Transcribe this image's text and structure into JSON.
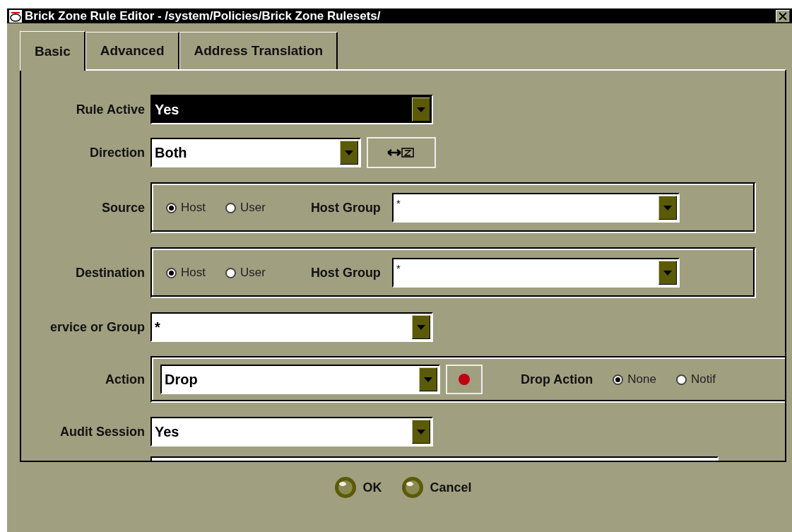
{
  "window": {
    "title": "Brick Zone Rule Editor - /system/Policies/Brick Zone Rulesets/"
  },
  "tabs": [
    {
      "label": "Basic",
      "selected": true
    },
    {
      "label": "Advanced",
      "selected": false
    },
    {
      "label": "Address Translation",
      "selected": false
    }
  ],
  "fields": [
    {
      "kind": "combo",
      "label": "Rule Active",
      "value": "Yes",
      "highlighted": true
    },
    {
      "kind": "combo-with-button",
      "label": "Direction",
      "value": "Both",
      "highlighted": false
    },
    {
      "kind": "endpoint",
      "label": "Source",
      "options": [
        {
          "label": "Host",
          "selected": true
        },
        {
          "label": "User",
          "selected": false
        }
      ],
      "group_label": "Host Group",
      "group_value": "*"
    },
    {
      "kind": "endpoint",
      "label": "Destination",
      "options": [
        {
          "label": "Host",
          "selected": true
        },
        {
          "label": "User",
          "selected": false
        }
      ],
      "group_label": "Host Group",
      "group_value": "*"
    },
    {
      "kind": "combo",
      "label": "ervice or Group",
      "value": "*",
      "highlighted": false
    },
    {
      "kind": "action",
      "label": "Action",
      "value": "Drop",
      "drop_label": "Drop Action",
      "options": [
        {
          "label": "None",
          "selected": true
        },
        {
          "label": "Notif",
          "selected": false
        }
      ]
    },
    {
      "kind": "combo",
      "label": "Audit Session",
      "value": "Yes",
      "highlighted": false
    },
    {
      "kind": "text"
    }
  ],
  "buttons": [
    {
      "label": "OK"
    },
    {
      "label": "Cancel"
    }
  ]
}
